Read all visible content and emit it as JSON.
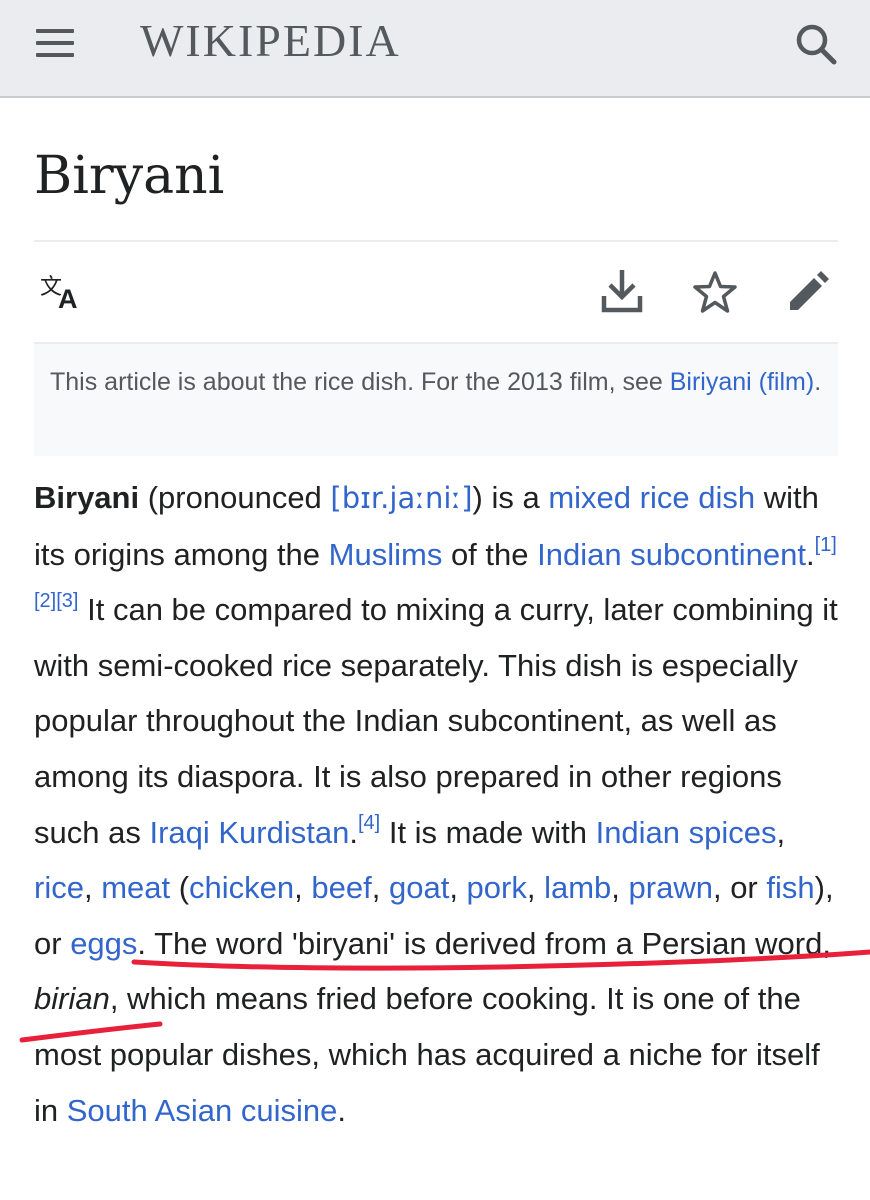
{
  "header": {
    "wordmark": "WIKIPEDIA",
    "menu_icon": "hamburger-menu-icon",
    "search_icon": "search-icon"
  },
  "page": {
    "title": "Biryani"
  },
  "toolbar": {
    "icons": [
      "language-icon",
      "download-icon",
      "star-icon",
      "edit-icon"
    ]
  },
  "hatnote": {
    "text_before": "This article is about the rice dish. For the 2013 film, see ",
    "link": "Biriyani (film)",
    "text_after": "."
  },
  "article": {
    "bold_term": "Biryani",
    "t1": " (pronounced ",
    "ipa": "[bɪr.jaːniː]",
    "t2": ") is a ",
    "l_mixed": "mixed rice dish",
    "t3": " with its origins among the ",
    "l_muslims": "Muslims",
    "t4": " of the ",
    "l_subcontinent": "Indian subcontinent",
    "t5": ".",
    "ref1": "[1]",
    "ref2": "[2]",
    "ref3": "[3]",
    "t6": " It can be compared to mixing a curry, later combining it with semi-cooked rice separately. This dish is especially popular throughout the Indian subcontinent, as well as among its diaspora. It is also prepared in other regions such as ",
    "l_kurdistan": "Iraqi Kurdistan",
    "t7": ".",
    "ref4": "[4]",
    "t8": " It is made with ",
    "l_spices": "Indian spices",
    "t9": ", ",
    "l_rice": "rice",
    "t10": ", ",
    "l_meat": "meat",
    "t11": " (",
    "l_chicken": "chicken",
    "c1": ", ",
    "l_beef": "beef",
    "c2": ", ",
    "l_goat": "goat",
    "c3": ", ",
    "l_pork": "pork",
    "c4": ", ",
    "l_lamb": "lamb",
    "c5": ", ",
    "l_prawn": "prawn",
    "t12": ", or ",
    "l_fish": "fish",
    "t13": "), or ",
    "l_eggs": "eggs",
    "t14": ". The word 'biryani' is derived from a Persian word, ",
    "italic_word": "birian",
    "t15": ", which means fried before cooking. It is one of the most popular dishes, which has acquired a niche for itself in ",
    "l_cuisine": "South Asian cuisine",
    "t16": "."
  },
  "colors": {
    "link": "#3366cc",
    "header_bg": "#eaecf0",
    "hatnote_bg": "#f8f9fa",
    "annotation_stroke": "#e8203a"
  }
}
